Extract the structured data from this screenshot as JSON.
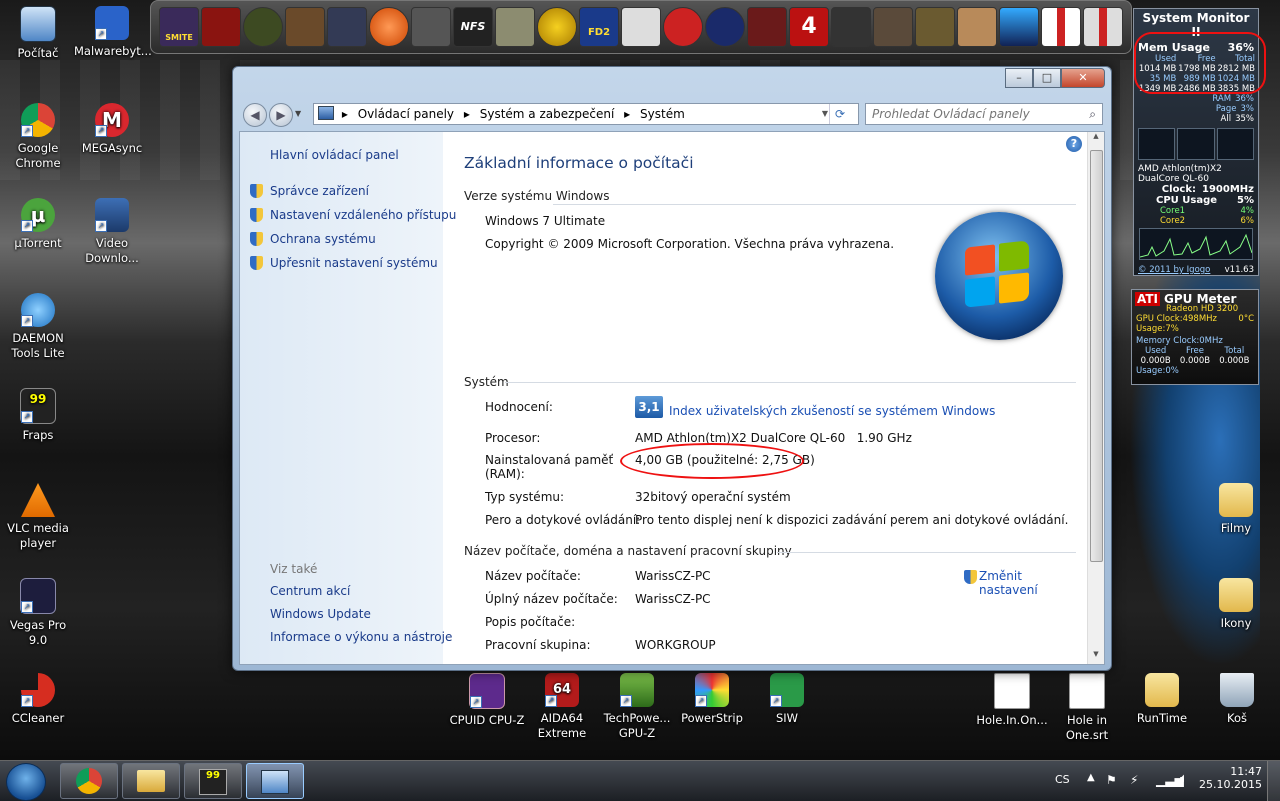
{
  "desktop": {
    "icons_left": [
      {
        "label": "Počítač",
        "name": "computer-icon"
      },
      {
        "label": "Google Chrome",
        "name": "chrome-icon"
      },
      {
        "label": "µTorrent",
        "name": "utorrent-icon"
      },
      {
        "label": "DAEMON Tools Lite",
        "name": "daemon-tools-icon"
      },
      {
        "label": "Fraps",
        "name": "fraps-icon"
      },
      {
        "label": "VLC media player",
        "name": "vlc-icon"
      },
      {
        "label": "Vegas Pro 9.0",
        "name": "vegas-icon"
      },
      {
        "label": "CCleaner",
        "name": "ccleaner-icon"
      }
    ],
    "icons_col2": [
      {
        "label": "Malwarebyt...",
        "name": "malwarebytes-icon"
      },
      {
        "label": "MEGAsync",
        "name": "megasync-icon"
      },
      {
        "label": "Video Downlo...",
        "name": "video-downloader-icon"
      }
    ],
    "icons_bottom": [
      {
        "label": "CPUID CPU-Z",
        "name": "cpuz-icon"
      },
      {
        "label": "AIDA64 Extreme",
        "name": "aida64-icon"
      },
      {
        "label": "TechPowe... GPU-Z",
        "name": "gpuz-icon"
      },
      {
        "label": "PowerStrip",
        "name": "powerstrip-icon"
      },
      {
        "label": "SIW",
        "name": "siw-icon"
      },
      {
        "label": "Hole.In.On...",
        "name": "video-file-icon"
      },
      {
        "label": "Hole in One.srt",
        "name": "srt-file-icon"
      },
      {
        "label": "RunTime",
        "name": "runtime-folder-icon"
      },
      {
        "label": "Koš",
        "name": "recycle-bin-icon"
      }
    ],
    "icons_right": [
      {
        "label": "Filmy",
        "name": "filmy-folder-icon"
      },
      {
        "label": "Ikony",
        "name": "ikony-folder-icon"
      }
    ]
  },
  "launcher": {
    "icons": [
      "smite-icon",
      "game2-icon",
      "game3-icon",
      "game4-icon",
      "game5-icon",
      "game6-icon",
      "world-of-tanks-icon",
      "nfs-icon",
      "counter-strike-icon",
      "nuclear-icon",
      "fifa-icon",
      "assassins-creed-icon",
      "arrow-back-icon",
      "unreal-icon",
      "wolfenstein-icon",
      "left4dead-icon",
      "soldier-icon",
      "game18-icon",
      "gothic-icon",
      "gta-icon",
      "car-game-icon",
      "cross-icon-1",
      "cross-icon-2"
    ],
    "labels": {
      "smite": "SMITE",
      "nfs": "NFS",
      "fifa": "FD2",
      "left4dead": "4"
    }
  },
  "system_monitor": {
    "title": "System Monitor II",
    "mem_label": "Mem Usage",
    "mem_percent": "36%",
    "cols": [
      "Used",
      "Free",
      "Total"
    ],
    "rows": [
      [
        "1014 MB",
        "1798 MB",
        "2812 MB"
      ],
      [
        "35 MB",
        "989 MB",
        "1024 MB"
      ],
      [
        "1349 MB",
        "2486 MB",
        "3835 MB"
      ]
    ],
    "ram_label": "RAM",
    "ram_percent": "36%",
    "page_label": "Page",
    "page_percent": "3%",
    "all_label": "All",
    "all_percent": "35%",
    "cpu_name": "AMD Athlon(tm)X2",
    "cpu_sub": "DualCore QL-60",
    "clock_label": "Clock:",
    "clock_value": "1900MHz",
    "cpu_usage_label": "CPU Usage",
    "cpu_usage": "5%",
    "core1_label": "Core1",
    "core1": "4%",
    "core2_label": "Core2",
    "core2": "6%",
    "footer_link": "© 2011 by Igogo",
    "version": "v11.63"
  },
  "gpu_meter": {
    "title": "GPU Meter",
    "brand": "ATI",
    "model": "Radeon HD 3200",
    "clock": "GPU Clock:498MHz",
    "temp": "0°C",
    "usage": "Usage:7%",
    "mem_clock": "Memory Clock:0MHz",
    "cols": [
      "Used",
      "Free",
      "Total"
    ],
    "vals": [
      "0.000B",
      "0.000B",
      "0.000B"
    ],
    "mem_usage": "Usage:0%"
  },
  "window": {
    "breadcrumb": [
      "Ovládací panely",
      "Systém a zabezpečení",
      "Systém"
    ],
    "search_placeholder": "Prohledat Ovládací panely",
    "left_links": {
      "home": "Hlavní ovládací panel",
      "items": [
        "Správce zařízení",
        "Nastavení vzdáleného přístupu",
        "Ochrana systému",
        "Upřesnit nastavení systému"
      ],
      "see_also": "Viz také",
      "also": [
        "Centrum akcí",
        "Windows Update",
        "Informace o výkonu a nástroje"
      ]
    },
    "heading": "Základní informace o počítači",
    "edition_title": "Verze systému Windows",
    "edition": "Windows 7 Ultimate",
    "copyright": "Copyright © 2009 Microsoft Corporation. Všechna práva vyhrazena.",
    "system_title": "Systém",
    "rating_label": "Hodnocení:",
    "rating_badge": "3,1",
    "rating_link": "Index uživatelských zkušeností se systémem Windows",
    "cpu_label": "Procesor:",
    "cpu_value": "AMD Athlon(tm)X2 DualCore QL-60   1.90 GHz",
    "ram_label_1": "Nainstalovaná paměť",
    "ram_label_2": "(RAM):",
    "ram_value": "4,00 GB (použitelné: 2,75 GB)",
    "systype_label": "Typ systému:",
    "systype_value": "32bitový operační systém",
    "pen_label": "Pero a dotykové ovládání:",
    "pen_value": "Pro tento displej není k dispozici zadávání perem ani dotykové ovládání.",
    "names_title": "Název počítače, doména a nastavení pracovní skupiny",
    "change_settings": "Změnit nastavení",
    "pcname_label": "Název počítače:",
    "pcname_value": "WarissCZ-PC",
    "fullname_label": "Úplný název počítače:",
    "fullname_value": "WarissCZ-PC",
    "desc_label": "Popis počítače:",
    "workgroup_label": "Pracovní skupina:",
    "workgroup_value": "WORKGROUP"
  },
  "taskbar": {
    "language": "CS",
    "time": "11:47",
    "date": "25.10.2015"
  }
}
